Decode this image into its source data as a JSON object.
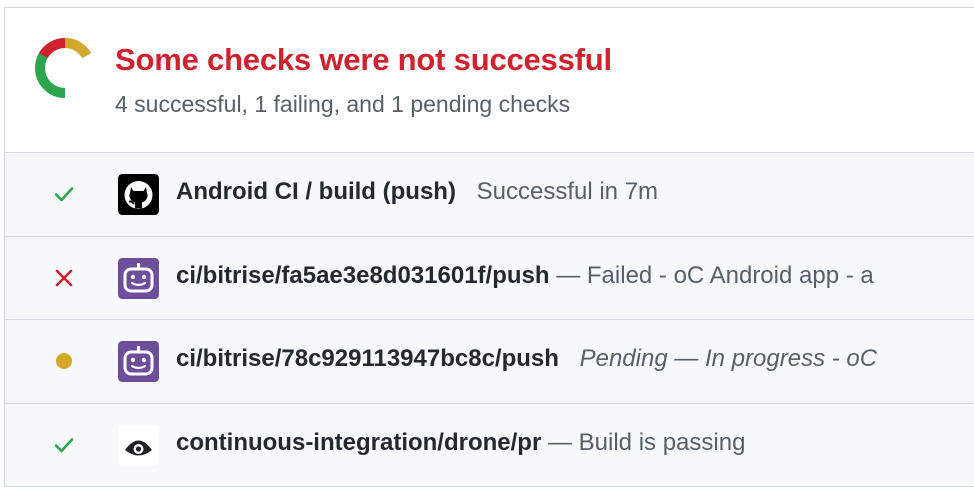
{
  "summary": {
    "title": "Some checks were not successful",
    "subtitle": "4 successful, 1 failing, and 1 pending checks"
  },
  "colors": {
    "success": "#2da44e",
    "failure": "#cf222e",
    "pending": "#d4a72c",
    "bitrise": "#6c4e9a"
  },
  "checks": [
    {
      "status": "success",
      "status_icon": "check-icon",
      "app_icon": "github-icon",
      "name": "Android CI / build (push)",
      "separator": "",
      "description": "Successful in 7m",
      "italic": false
    },
    {
      "status": "failure",
      "status_icon": "x-icon",
      "app_icon": "bitrise-icon",
      "name": "ci/bitrise/fa5ae3e8d031601f/push",
      "separator": " — ",
      "description": "Failed - oC Android app - a",
      "italic": false
    },
    {
      "status": "pending",
      "status_icon": "dot-icon",
      "app_icon": "bitrise-icon",
      "name": "ci/bitrise/78c929113947bc8c/push",
      "separator": "",
      "description": "Pending — In progress - oC",
      "italic": true
    },
    {
      "status": "success",
      "status_icon": "check-icon",
      "app_icon": "drone-icon",
      "name": "continuous-integration/drone/pr",
      "separator": " — ",
      "description": "Build is passing",
      "italic": false
    }
  ]
}
